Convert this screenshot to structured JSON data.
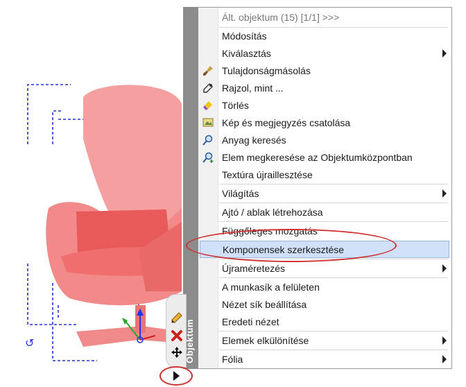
{
  "menu": {
    "side_label": "Objektum",
    "header": "Ált. objektum (15) [1/1] >>>",
    "items": [
      {
        "label": "Módosítás",
        "icon": "",
        "submenu": false
      },
      {
        "label": "Kiválasztás",
        "icon": "",
        "submenu": true
      },
      {
        "label": "Tulajdonságmásolás",
        "icon": "brush-icon",
        "submenu": false
      },
      {
        "label": "Rajzol, mint ...",
        "icon": "eyedropper-icon",
        "submenu": false
      },
      {
        "label": "Törlés",
        "icon": "eraser-icon",
        "submenu": false
      },
      {
        "label": "Kép és megjegyzés csatolása",
        "icon": "image-note-icon",
        "submenu": false
      },
      {
        "label": "Anyag keresés",
        "icon": "magnifier-icon",
        "submenu": false
      },
      {
        "label": "Elem megkeresése az Objektumközpontban",
        "icon": "magnifier-plus-icon",
        "submenu": false
      },
      {
        "label": "Textúra újraillesztése",
        "icon": "",
        "submenu": false
      },
      {
        "label": "Világítás",
        "icon": "",
        "submenu": true
      },
      {
        "label": "Ajtó / ablak létrehozása",
        "icon": "",
        "submenu": false
      },
      {
        "label": "Függőleges mozgatás",
        "icon": "",
        "submenu": false
      },
      {
        "label": "Komponensek szerkesztése",
        "icon": "",
        "submenu": false,
        "highlighted": true
      },
      {
        "label": "Újraméretezés",
        "icon": "",
        "submenu": true
      },
      {
        "label": "A munkasík a felületen",
        "icon": "",
        "submenu": false
      },
      {
        "label": "Nézet sík beállítása",
        "icon": "",
        "submenu": false
      },
      {
        "label": "Eredeti nézet",
        "icon": "",
        "submenu": false
      },
      {
        "label": "Elemek elkülönítése",
        "icon": "",
        "submenu": true
      },
      {
        "label": "Fólia",
        "icon": "",
        "submenu": true
      }
    ]
  },
  "mini_toolbar": {
    "buttons": [
      "pencil-icon",
      "delete-x-icon",
      "move-arrows-icon",
      "expand-arrow-icon"
    ]
  },
  "colors": {
    "highlight": "#cfe0f8",
    "annotation": "#d03030",
    "chair": "#f08a8a",
    "dashed_outline": "#2233cc"
  }
}
